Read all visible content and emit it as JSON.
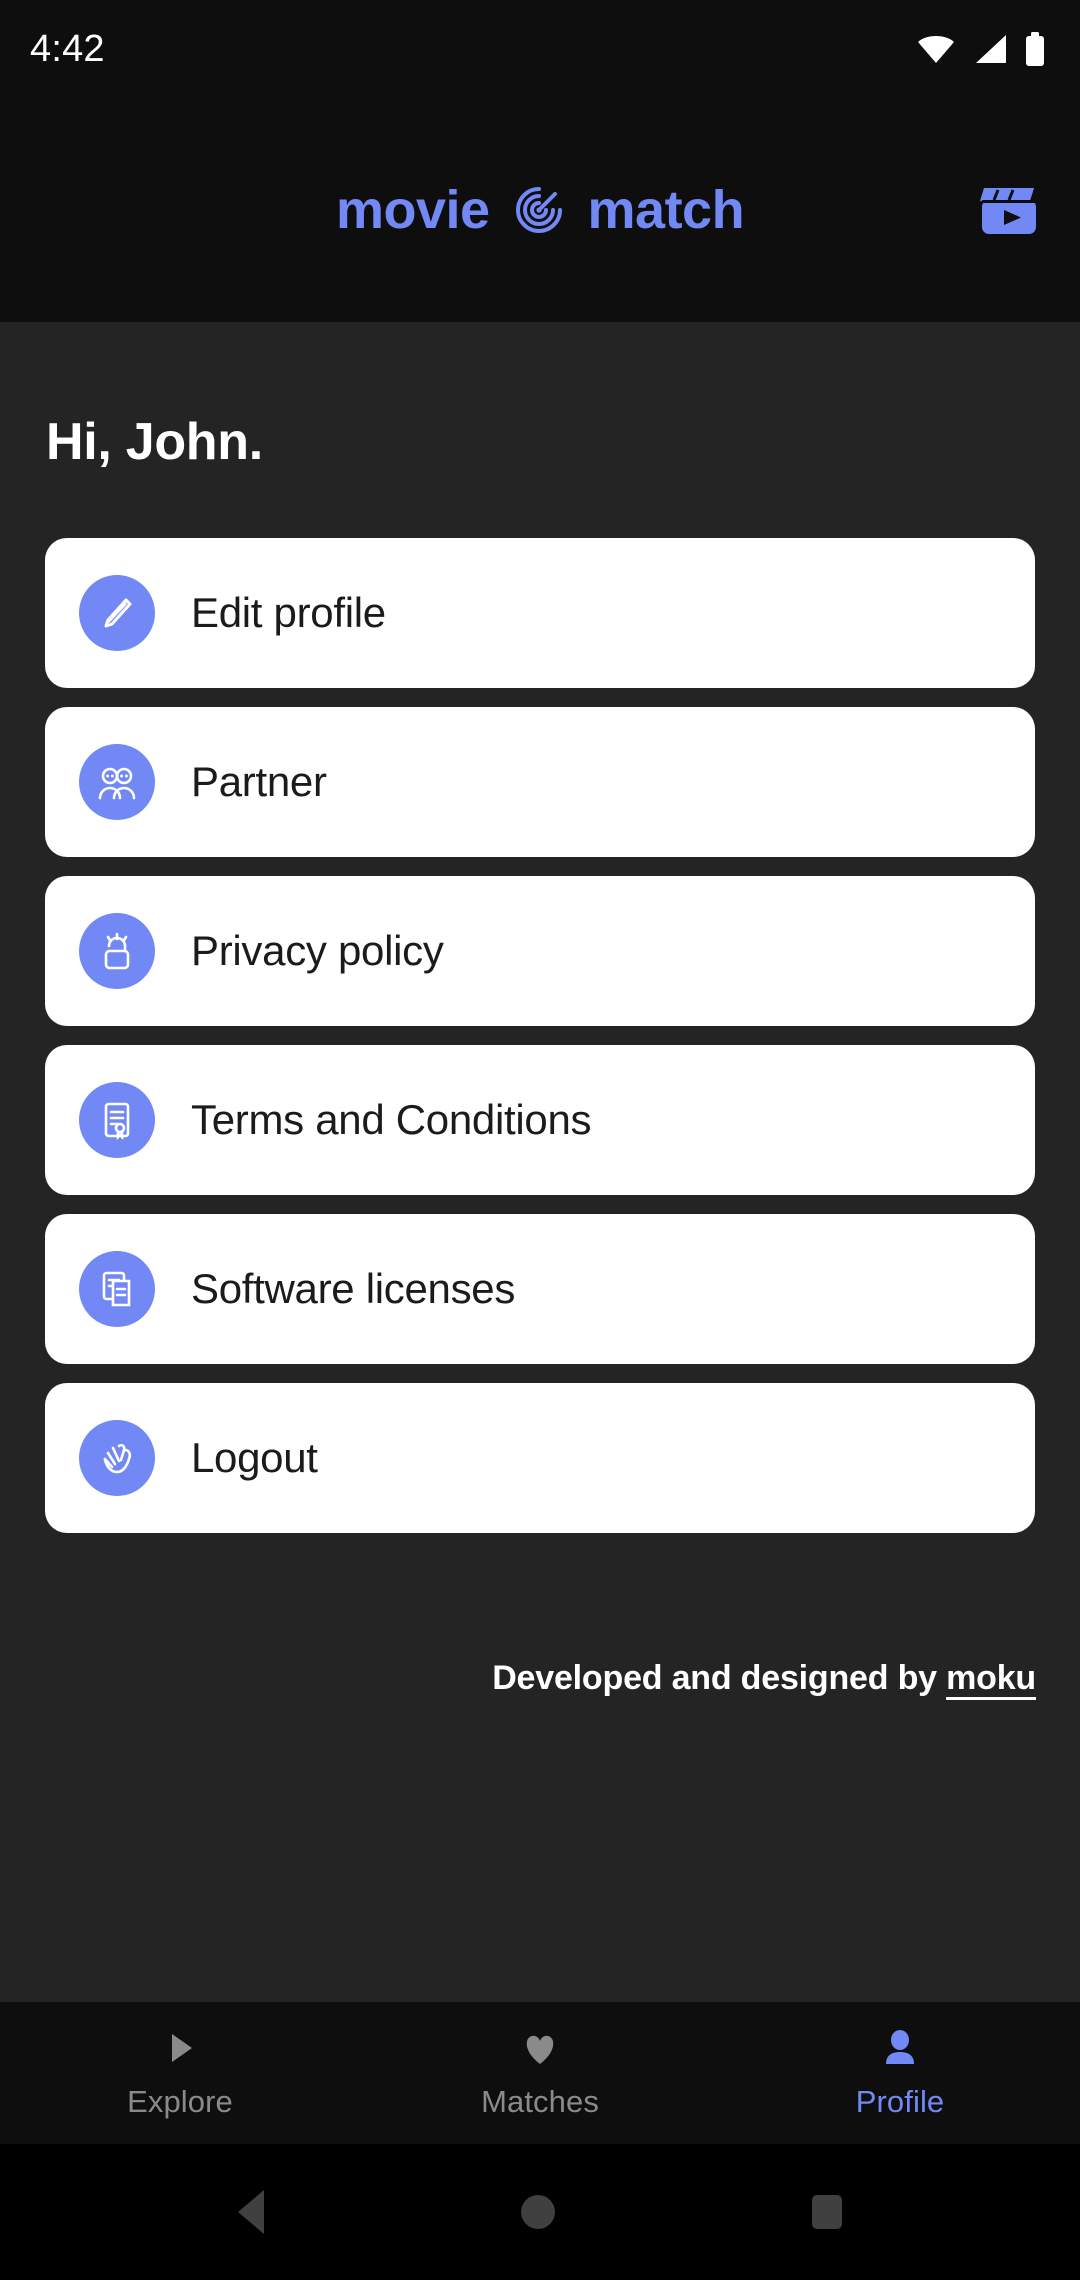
{
  "status_bar": {
    "time": "4:42",
    "icons": [
      "wifi-icon",
      "cellular-signal-icon",
      "battery-icon"
    ]
  },
  "app_bar": {
    "brand_left": "movie",
    "brand_right": "match",
    "brand_mark": "radar-spiral-icon",
    "action_icon": "movie-clapperboard-icon",
    "accent_color": "#7289f5"
  },
  "main": {
    "greeting": "Hi, John.",
    "menu": [
      {
        "label": "Edit profile",
        "icon": "pencil-icon"
      },
      {
        "label": "Partner",
        "icon": "two-people-icon"
      },
      {
        "label": "Privacy policy",
        "icon": "lock-alert-icon"
      },
      {
        "label": "Terms and Conditions",
        "icon": "certificate-document-icon"
      },
      {
        "label": "Software licenses",
        "icon": "stacked-documents-icon"
      },
      {
        "label": "Logout",
        "icon": "waving-hand-icon"
      }
    ],
    "credit_prefix": "Developed and designed by ",
    "credit_link": "moku"
  },
  "bottom_nav": {
    "items": [
      {
        "label": "Explore",
        "icon": "play-triangle-icon",
        "active": false
      },
      {
        "label": "Matches",
        "icon": "heart-icon",
        "active": false
      },
      {
        "label": "Profile",
        "icon": "person-icon",
        "active": true
      }
    ],
    "active_color": "#7289f5",
    "inactive_color": "#8a8a8a"
  },
  "system_nav": {
    "back": "back-triangle-icon",
    "home": "home-circle-icon",
    "recents": "recents-square-icon"
  }
}
